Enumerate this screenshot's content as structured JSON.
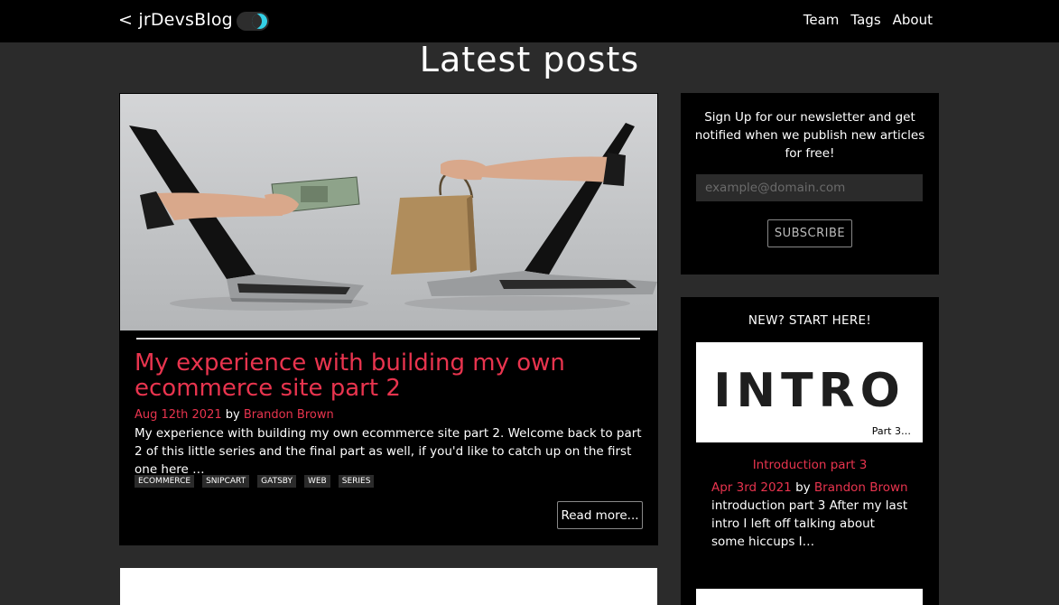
{
  "header": {
    "logo": "< jrDevsBlog />",
    "nav": [
      "Team",
      "Tags",
      "About"
    ]
  },
  "page_title": "Latest posts",
  "post": {
    "title": "My experience with building my own ecommerce site part 2",
    "date": "Aug 12th 2021",
    "by": "by",
    "author": "Brandon Brown",
    "excerpt": "My experience with building my own ecommerce site part 2. Welcome back to part 2 of this little series and the final part as well, if you'd like to catch up on the first one here …",
    "tags": [
      "ECOMMERCE",
      "SNIPCART",
      "GATSBY",
      "WEB",
      "SERIES"
    ],
    "read_more": "Read more..."
  },
  "newsletter": {
    "text": "Sign Up for our newsletter and get notified when we publish new articles for free!",
    "placeholder": "example@domain.com",
    "button": "SUBSCRIBE"
  },
  "start_here": {
    "heading": "NEW? START HERE!",
    "thumb_word": "INTRO",
    "thumb_caption": "Part 3…",
    "title": "Introduction part 3",
    "date": "Apr 3rd 2021",
    "by": "by",
    "author": "Brandon Brown",
    "excerpt": "introduction part 3 After my last intro I left off talking about some hiccups I…"
  },
  "colors": {
    "accent": "#e8344e",
    "toggle": "#34d0e6",
    "background": "#2b2b2b",
    "card": "#000000"
  }
}
